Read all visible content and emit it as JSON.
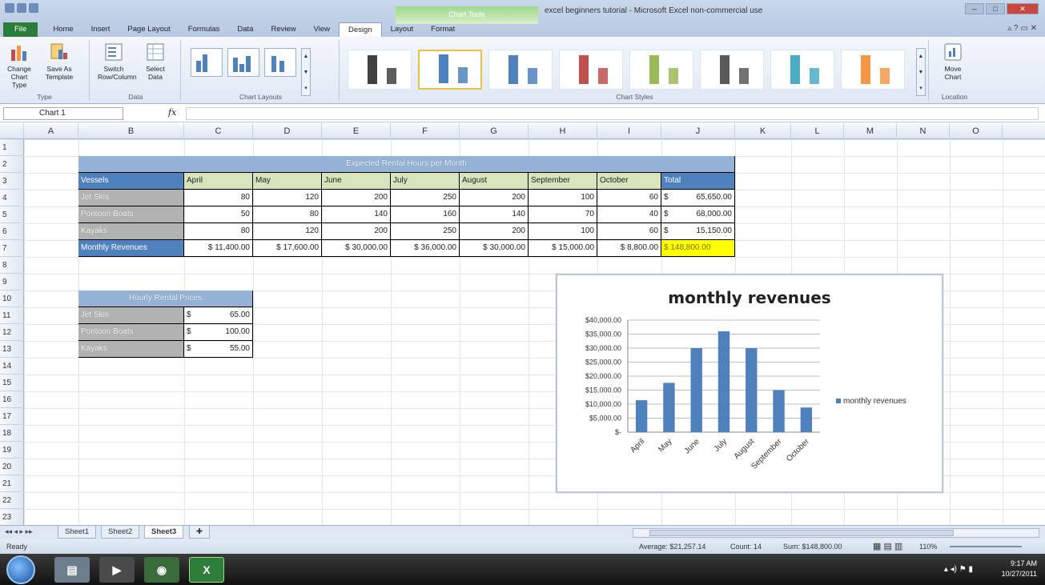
{
  "window": {
    "title": "excel beginners tutorial - Microsoft Excel non-commercial use",
    "context_tab_header": "Chart Tools",
    "tabs": [
      "File",
      "Home",
      "Insert",
      "Page Layout",
      "Formulas",
      "Data",
      "Review",
      "View",
      "Design",
      "Layout",
      "Format"
    ],
    "active_tab": "Design"
  },
  "ribbon": {
    "groups": {
      "type": {
        "label": "Type",
        "buttons": [
          "Change Chart Type",
          "Save As Template"
        ]
      },
      "data": {
        "label": "Data",
        "buttons": [
          "Switch Row/Column",
          "Select Data"
        ]
      },
      "layouts": {
        "label": "Chart Layouts"
      },
      "styles": {
        "label": "Chart Styles",
        "colors": [
          "#404040",
          "#4f81bd",
          "#4f81bd",
          "#c0504d",
          "#9bbb59",
          "#595959",
          "#4bacc6",
          "#f79646"
        ]
      },
      "location": {
        "label": "Location",
        "button": "Move Chart"
      }
    }
  },
  "formula_bar": {
    "name_box": "Chart 1",
    "fx": "fx",
    "value": ""
  },
  "columns": [
    "A",
    "B",
    "C",
    "D",
    "E",
    "F",
    "G",
    "H",
    "I",
    "J",
    "K",
    "L",
    "M",
    "N",
    "O"
  ],
  "rows": [
    "1",
    "2",
    "3",
    "4",
    "5",
    "6",
    "7",
    "8",
    "9",
    "10",
    "11",
    "12",
    "13",
    "14",
    "15",
    "16",
    "17",
    "18",
    "19",
    "20",
    "21",
    "22",
    "23"
  ],
  "rental_table": {
    "title": "Expected Rental Hours per Month",
    "header_label": "Vessels",
    "months": [
      "April",
      "May",
      "June",
      "July",
      "August",
      "September",
      "October"
    ],
    "total_label": "Total",
    "rows": [
      {
        "name": "Jet Skis",
        "values": [
          "80",
          "120",
          "200",
          "250",
          "200",
          "100",
          "60"
        ],
        "total": "65,650.00"
      },
      {
        "name": "Pontoon Boats",
        "values": [
          "50",
          "80",
          "140",
          "160",
          "140",
          "70",
          "40"
        ],
        "total": "68,000.00"
      },
      {
        "name": "Kayaks",
        "values": [
          "80",
          "120",
          "200",
          "250",
          "200",
          "100",
          "60"
        ],
        "total": "15,150.00"
      }
    ],
    "revenue_label": "Monthly Revenues",
    "revenues": [
      "$ 11,400.00",
      "$ 17,600.00",
      "$ 30,000.00",
      "$ 36,000.00",
      "$ 30,000.00",
      "$ 15,000.00",
      "$ 8,800.00"
    ],
    "grand_total": "$ 148,800.00",
    "currency": "$"
  },
  "price_table": {
    "title": "Hourly Rental Prices",
    "rows": [
      {
        "name": "Jet Skis",
        "currency": "$",
        "price": "65.00"
      },
      {
        "name": "Pontoon Boats",
        "currency": "$",
        "price": "100.00"
      },
      {
        "name": "Kayaks",
        "currency": "$",
        "price": "55.00"
      }
    ]
  },
  "chart_data": {
    "type": "bar",
    "title": "monthly revenues",
    "categories": [
      "April",
      "May",
      "June",
      "July",
      "August",
      "September",
      "October"
    ],
    "series": [
      {
        "name": "monthly revenues",
        "values": [
          11400,
          17600,
          30000,
          36000,
          30000,
          15000,
          8800
        ],
        "color": "#4f81bd"
      }
    ],
    "ylim": [
      0,
      40000
    ],
    "yticks": [
      "$-",
      "$5,000.00",
      "$10,000.00",
      "$15,000.00",
      "$20,000.00",
      "$25,000.00",
      "$30,000.00",
      "$35,000.00",
      "$40,000.00"
    ],
    "xlabel": "",
    "ylabel": "",
    "grid": true,
    "legend": "right"
  },
  "sheet_tabs": [
    "Sheet1",
    "Sheet2",
    "Sheet3"
  ],
  "active_sheet": "Sheet3",
  "status": {
    "mode": "Ready",
    "average": "Average: $21,257.14",
    "count": "Count: 14",
    "sum": "Sum: $148,800.00",
    "zoom": "110%"
  },
  "taskbar": {
    "time": "9:17 AM",
    "date": "10/27/2011"
  }
}
